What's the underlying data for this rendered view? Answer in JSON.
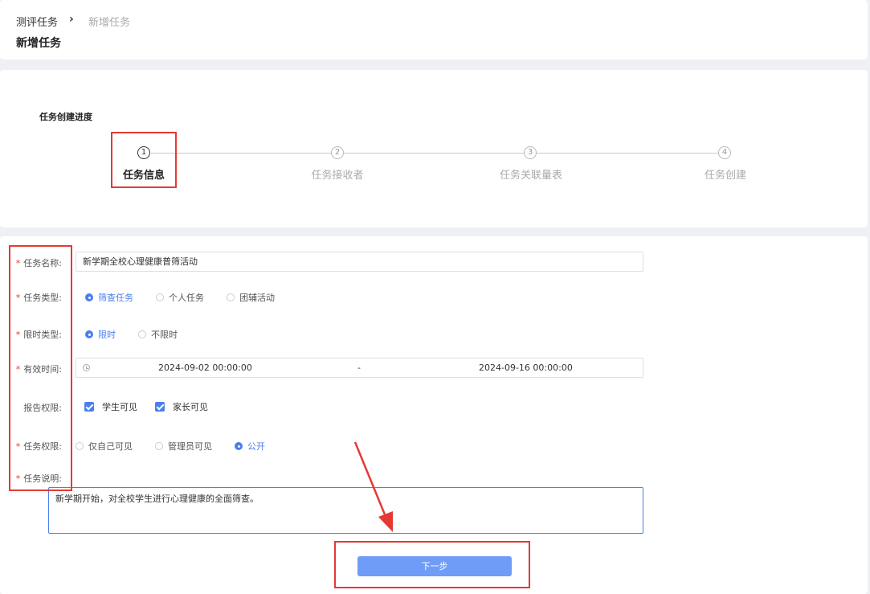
{
  "breadcrumb": {
    "root": "测评任务",
    "separator": "›",
    "current": "新增任务"
  },
  "page_title": "新增任务",
  "progress": {
    "title": "任务创建进度",
    "current_step": 1,
    "steps": [
      {
        "number": "1",
        "label": "任务信息"
      },
      {
        "number": "2",
        "label": "任务接收者"
      },
      {
        "number": "3",
        "label": "任务关联量表"
      },
      {
        "number": "4",
        "label": "任务创建"
      }
    ]
  },
  "form": {
    "required_mark": "*",
    "task_name": {
      "label": "任务名称:",
      "value": "新学期全校心理健康普筛活动"
    },
    "task_type": {
      "label": "任务类型:",
      "options": [
        "筛查任务",
        "个人任务",
        "团辅活动"
      ],
      "selected": "筛查任务"
    },
    "time_limit": {
      "label": "限时类型:",
      "options": [
        "限时",
        "不限时"
      ],
      "selected": "限时"
    },
    "valid_time": {
      "label": "有效时间:",
      "start": "2024-09-02 00:00:00",
      "separator": "-",
      "end": "2024-09-16 00:00:00"
    },
    "report_permission": {
      "label": "报告权限:",
      "options": [
        "学生可见",
        "家长可见"
      ],
      "checked": [
        "学生可见",
        "家长可见"
      ]
    },
    "task_permission": {
      "label": "任务权限:",
      "options": [
        "仅自己可见",
        "管理员可见",
        "公开"
      ],
      "selected": "公开"
    },
    "task_description": {
      "label": "任务说明:",
      "value": "新学期开始，对全校学生进行心理健康的全面筛查。"
    },
    "next_button": "下一步"
  },
  "colors": {
    "accent": "#4a7ef2",
    "button": "#6e9cf7",
    "highlight": "#e53935"
  }
}
